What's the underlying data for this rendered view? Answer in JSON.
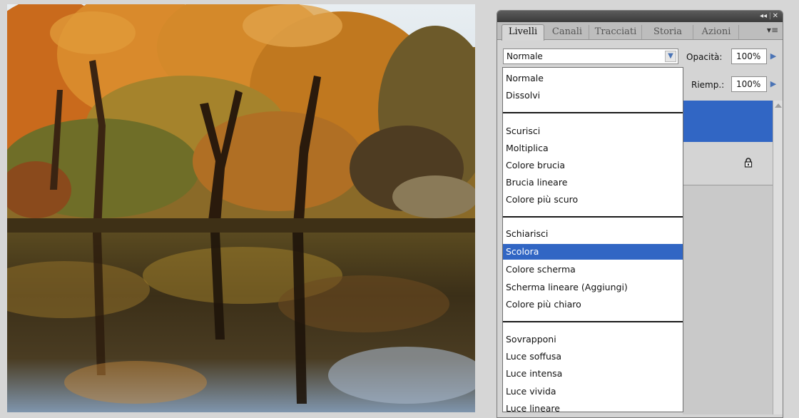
{
  "panel": {
    "tabs": [
      {
        "label": "Livelli",
        "active": true
      },
      {
        "label": "Canali",
        "active": false
      },
      {
        "label": "Tracciati",
        "active": false
      },
      {
        "label": "Storia",
        "active": false
      },
      {
        "label": "Azioni",
        "active": false
      }
    ],
    "blend_mode": "Normale",
    "opacity_label": "Opacità:",
    "opacity_value": "100%",
    "fill_label": "Riemp.:",
    "fill_value": "100%"
  },
  "dropdown": {
    "groups": [
      [
        "Normale",
        "Dissolvi"
      ],
      [
        "Scurisci",
        "Moltiplica",
        "Colore brucia",
        "Brucia lineare",
        "Colore più scuro"
      ],
      [
        "Schiarisci",
        "Scolora",
        "Colore scherma",
        "Scherma lineare (Aggiungi)",
        "Colore più chiaro"
      ],
      [
        "Sovrapponi",
        "Luce soffusa",
        "Luce intensa",
        "Luce vivida",
        "Luce lineare"
      ]
    ],
    "selected": "Scolora"
  },
  "icons": {
    "lock": "lock-icon",
    "dropdown_arrow": "chevron-down-icon",
    "panel_menu": "panel-menu-icon",
    "collapse": "collapse-icon",
    "close": "close-icon"
  },
  "colors": {
    "selection": "#3166c4",
    "panel_bg": "#d4d4d4",
    "titlebar": "#4a4a4a"
  }
}
